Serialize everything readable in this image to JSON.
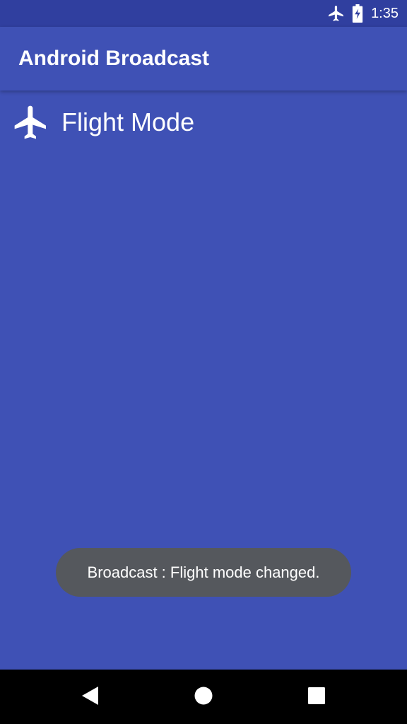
{
  "status_bar": {
    "time": "1:35",
    "icons": [
      "airplane-icon",
      "battery-charging-icon"
    ]
  },
  "app_bar": {
    "title": "Android Broadcast"
  },
  "content": {
    "flight_mode_label": "Flight Mode",
    "icon": "airplane-icon"
  },
  "toast": {
    "message": "Broadcast : Flight mode changed."
  },
  "nav_bar": {
    "buttons": [
      "back-icon",
      "home-icon",
      "recents-icon"
    ]
  },
  "colors": {
    "primary": "#3f51b5",
    "primary_dark": "#303f9f",
    "toast_bg": "#55585d",
    "nav_bg": "#000000",
    "text": "#ffffff"
  }
}
